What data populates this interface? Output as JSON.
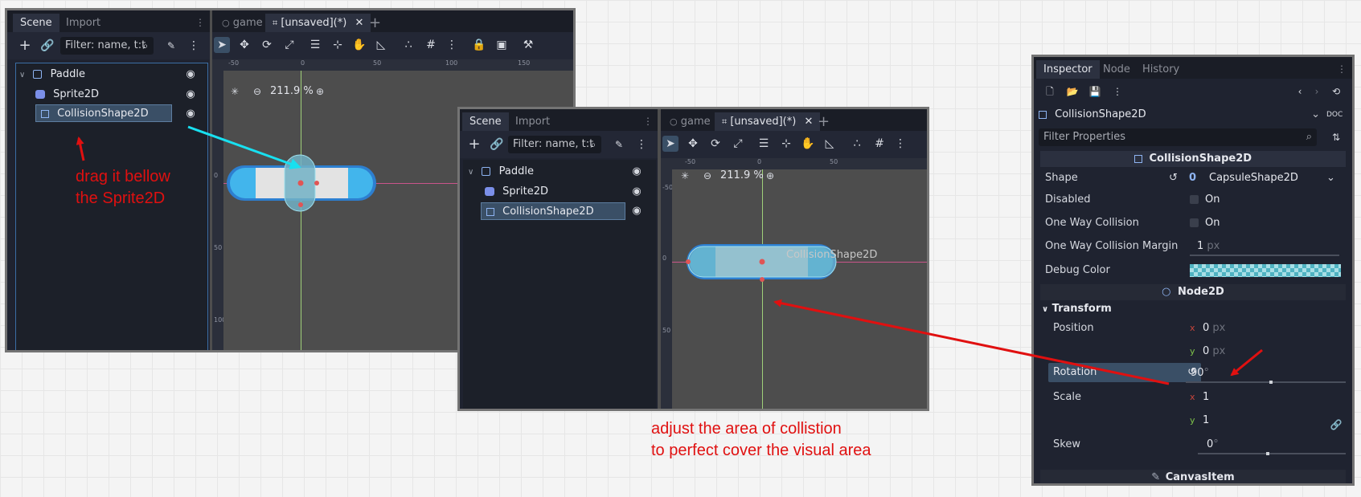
{
  "window1": {
    "scene_dock": {
      "tabs": [
        "Scene",
        "Import"
      ],
      "filter_placeholder": "Filter: name, t:t",
      "tree": [
        {
          "label": "Paddle",
          "icon": "node2d-icon"
        },
        {
          "label": "Sprite2D",
          "icon": "sprite2d-icon"
        },
        {
          "label": "CollisionShape2D",
          "icon": "collisionshape2d-icon",
          "selected": true
        }
      ]
    },
    "editor_tabs": [
      "game",
      "[unsaved](*)"
    ],
    "zoom": "211.9 %",
    "ruler_h": [
      "-50",
      "0",
      "50",
      "100",
      "150"
    ],
    "ruler_v": [
      "0",
      "50",
      "100"
    ]
  },
  "window2": {
    "scene_dock": {
      "tabs": [
        "Scene",
        "Import"
      ],
      "filter_placeholder": "Filter: name, t:t",
      "tree": [
        {
          "label": "Paddle",
          "icon": "node2d-icon"
        },
        {
          "label": "Sprite2D",
          "icon": "sprite2d-icon"
        },
        {
          "label": "CollisionShape2D",
          "icon": "collisionshape2d-icon",
          "selected": true
        }
      ]
    },
    "editor_tabs": [
      "game",
      "[unsaved](*)"
    ],
    "zoom": "211.9 %",
    "ruler_h": [
      "-50",
      "0",
      "50"
    ],
    "ruler_v": [
      "-50",
      "0",
      "50"
    ],
    "overlay_label": "CollisionShape2D"
  },
  "inspector": {
    "tabs": [
      "Inspector",
      "Node",
      "History"
    ],
    "node_selector": "CollisionShape2D",
    "filter_placeholder": "Filter Properties",
    "section_title": "CollisionShape2D",
    "shape_label": "Shape",
    "shape_value": "CapsuleShape2D",
    "disabled_label": "Disabled",
    "disabled_value": "On",
    "one_way_label": "One Way Collision",
    "one_way_value": "On",
    "margin_label": "One Way Collision Margin",
    "margin_value": "1",
    "margin_unit": "px",
    "debug_color_label": "Debug Color",
    "node2d_title": "Node2D",
    "transform_title": "Transform",
    "position_label": "Position",
    "position_x": "0",
    "position_y": "0",
    "position_unit": "px",
    "rotation_label": "Rotation",
    "rotation_value": "90",
    "rotation_unit": "°",
    "scale_label": "Scale",
    "scale_x": "1",
    "scale_y": "1",
    "skew_label": "Skew",
    "skew_value": "0",
    "skew_unit": "°",
    "canvasitem_title": "CanvasItem",
    "axis_x": "x",
    "axis_y": "y"
  },
  "annotations": {
    "note1_line1": "drag it bellow",
    "note1_line2": "the Sprite2D",
    "note2_line1": "adjust the area of collistion",
    "note2_line2": "to perfect cover the visual area"
  },
  "colors": {
    "annotation": "#e01010",
    "cyan_arrow": "#18e0f0",
    "accent": "#478cbf"
  }
}
